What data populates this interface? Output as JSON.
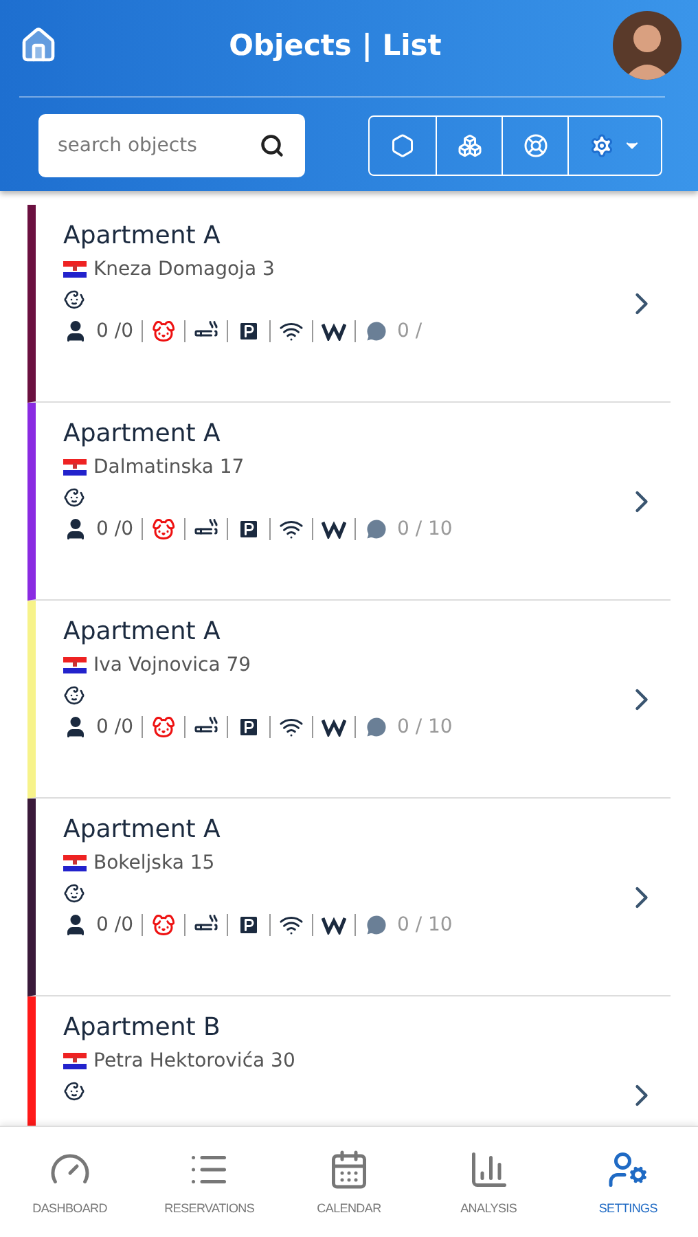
{
  "header": {
    "title": "Objects | List"
  },
  "search": {
    "placeholder": "search objects"
  },
  "objects": [
    {
      "name": "Apartment A",
      "address": "Kneza Domagoja 3",
      "color": "#6b1040",
      "guests": "0 /0",
      "messages": "0 /"
    },
    {
      "name": "Apartment A",
      "address": "Dalmatinska 17",
      "color": "#8a2be2",
      "guests": "0 /0",
      "messages": "0 / 10"
    },
    {
      "name": "Apartment A",
      "address": "Iva Vojnovica 79",
      "color": "#f7f38a",
      "guests": "0 /0",
      "messages": "0 / 10"
    },
    {
      "name": "Apartment A",
      "address": "Bokeljska 15",
      "color": "#3a1a3a",
      "guests": "0 /0",
      "messages": "0 / 10"
    },
    {
      "name": "Apartment B",
      "address": "Petra Hektorovića 30",
      "color": "#ff1a1a"
    }
  ],
  "nav": [
    {
      "label": "DASHBOARD",
      "kind": "dashboard",
      "selected": false
    },
    {
      "label": "RESERVATIONS",
      "kind": "reservations",
      "selected": false
    },
    {
      "label": "CALENDAR",
      "kind": "calendar",
      "selected": false
    },
    {
      "label": "ANALYSIS",
      "kind": "analysis",
      "selected": false
    },
    {
      "label": "SETTINGS",
      "kind": "settings",
      "selected": true
    }
  ]
}
